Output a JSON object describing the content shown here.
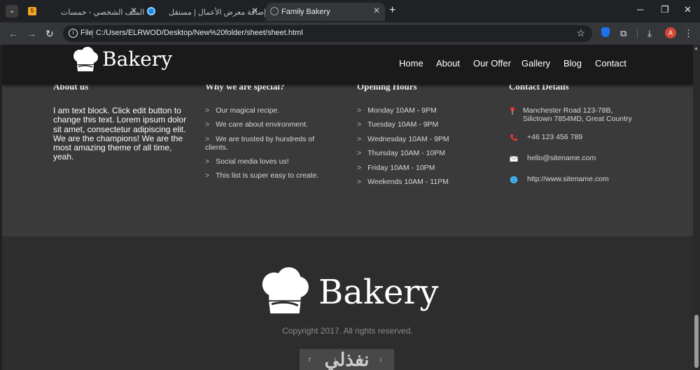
{
  "browser": {
    "tabs": [
      {
        "title": "الملف الشخصي - خمسات",
        "active": false
      },
      {
        "title": "إضافة معرض الأعمال | مستقل",
        "active": false
      },
      {
        "title": "Family Bakery",
        "active": true
      }
    ],
    "new_tab": "+",
    "minimize": "─",
    "restore": "❐",
    "close": "✕",
    "tab_close": "✕",
    "back": "←",
    "forward": "→",
    "reload": "↻",
    "file_chip": "File",
    "url": "C:/Users/ELRWOD/Desktop/New%20folder/sheet/sheet.html",
    "star": "☆",
    "profile_initial": "A",
    "tab_search": "⌄",
    "favicon_1": "5"
  },
  "header": {
    "logo_text": "Bakery",
    "nav": [
      "Home",
      "About",
      "Our Offer",
      "Gallery",
      "Blog",
      "Contact"
    ]
  },
  "about": {
    "title": "About us",
    "text": "I am text block. Click edit button to change this text. Lorem ipsum dolor sit amet, consectetur adipiscing elit. We are the champions! We are the most amazing theme of all time, yeah."
  },
  "special": {
    "title": "Why we are special?",
    "items": [
      "Our magical recipe.",
      "We care about environment.",
      "We are trusted by hundreds of clients.",
      "Social media loves us!",
      "This list is super easy to create."
    ]
  },
  "hours": {
    "title": "Opening Hours",
    "items": [
      "Monday 10AM - 9PM",
      "Tuesday 10AM - 9PM",
      "Wednesday 10AM - 9PM",
      "Thursday 10AM - 10PM",
      "Friday 10AM - 10PM",
      "Weekends 10AM - 11PM"
    ]
  },
  "contact": {
    "title": "Contact Details",
    "address": "Manchester Road 123-78B, Silictown 7854MD, Great Country",
    "phone": "+46 123 456 789",
    "email": "hello@sitename.com",
    "web": "http://www.sitename.com"
  },
  "footer": {
    "logo_text": "Bakery",
    "copyright": "Copyright 2017. All rights reserved.",
    "watermark": "نفذلي"
  },
  "colors": {
    "page_bg": "#3a3a3a",
    "header_bg": "#1a1a1a",
    "footer_bg": "#2d2d2d",
    "pin": "#e53935",
    "phone": "#e53935",
    "globe": "#4fc3f7"
  }
}
